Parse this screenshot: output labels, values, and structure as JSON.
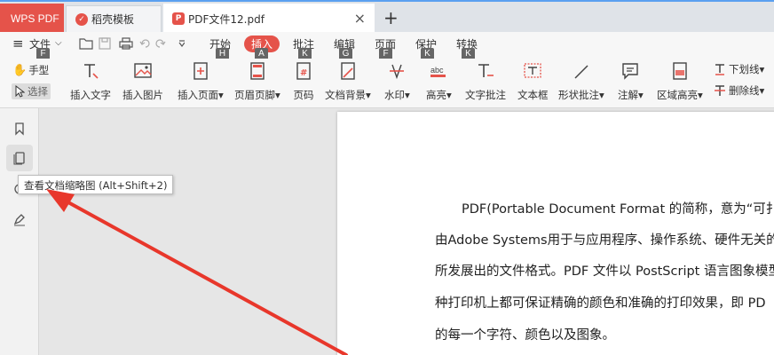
{
  "tabs": {
    "app_name": "WPS PDF",
    "template_tab": "稻壳模板",
    "document_tab": "PDF文件12.pdf",
    "close_glyph": "×",
    "add_glyph": "+"
  },
  "menu": {
    "file_label": "文件",
    "items": [
      {
        "label": "开始",
        "key": "H"
      },
      {
        "label": "插入",
        "key": "A",
        "active": true
      },
      {
        "label": "批注",
        "key": "K"
      },
      {
        "label": "编辑",
        "key": "G"
      },
      {
        "label": "页面",
        "key": "F"
      },
      {
        "label": "保护",
        "key": "K"
      },
      {
        "label": "转换",
        "key": "K"
      }
    ],
    "file_key": "F"
  },
  "toolbar": {
    "hand": "手型",
    "select": "选择",
    "tools": [
      {
        "label": "插入文字",
        "icon": "insert-text-icon"
      },
      {
        "label": "插入图片",
        "icon": "insert-image-icon"
      },
      {
        "label": "插入页面",
        "icon": "insert-page-icon",
        "dropdown": true
      },
      {
        "label": "页眉页脚",
        "icon": "header-footer-icon",
        "dropdown": true
      },
      {
        "label": "页码",
        "icon": "page-number-icon"
      },
      {
        "label": "文档背景",
        "icon": "doc-background-icon",
        "dropdown": true
      },
      {
        "label": "水印",
        "icon": "watermark-icon",
        "dropdown": true
      },
      {
        "label": "高亮",
        "icon": "highlight-icon",
        "dropdown": true
      },
      {
        "label": "文字批注",
        "icon": "text-comment-icon"
      },
      {
        "label": "文本框",
        "icon": "textbox-icon"
      },
      {
        "label": "形状批注",
        "icon": "shape-comment-icon",
        "dropdown": true
      },
      {
        "label": "注解",
        "icon": "note-icon",
        "dropdown": true
      },
      {
        "label": "区域高亮",
        "icon": "area-highlight-icon",
        "dropdown": true
      }
    ],
    "underline": "下划线",
    "strikethrough": "删除线"
  },
  "tooltip": "查看文档缩略图 (Alt+Shift+2)",
  "document": {
    "lines": [
      "PDF(Portable Document Format 的简称，意为“可扌",
      "由Adobe Systems用于与应用程序、操作系统、硬件无关的",
      "所发展出的文件格式。PDF 文件以 PostScript 语言图象模型",
      "种打印机上都可保证精确的颜色和准确的打印效果，即 PD",
      "的每一个字符、颜色以及图象。"
    ]
  },
  "colors": {
    "accent": "#e5534a",
    "arrow": "#e8372b"
  }
}
